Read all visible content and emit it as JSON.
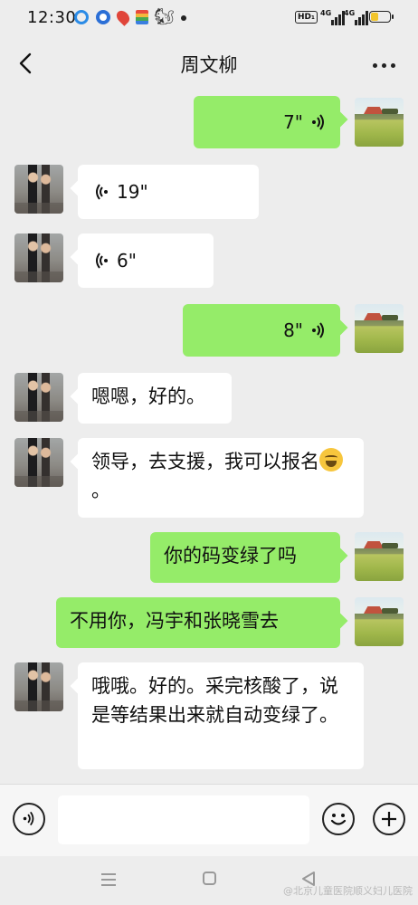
{
  "status_bar": {
    "time": "12:30",
    "hd_label": "HD₁",
    "sig1": "4G",
    "sig2": "4G"
  },
  "nav": {
    "title": "周文柳"
  },
  "messages": [
    {
      "from": "me",
      "type": "voice",
      "duration": "7\""
    },
    {
      "from": "other",
      "type": "voice",
      "duration": "19\""
    },
    {
      "from": "other",
      "type": "voice",
      "duration": "6\""
    },
    {
      "from": "me",
      "type": "voice",
      "duration": "8\""
    },
    {
      "from": "other",
      "type": "text",
      "text": "嗯嗯，好的。"
    },
    {
      "from": "other",
      "type": "text",
      "text": "领导，去支援，我可以报名",
      "trail": "。",
      "emoji": "laughing-tears-emoji"
    },
    {
      "from": "me",
      "type": "text",
      "text": "你的码变绿了吗"
    },
    {
      "from": "me",
      "type": "text",
      "text": "不用你，冯宇和张晓雪去"
    },
    {
      "from": "other",
      "type": "text",
      "text": "哦哦。好的。采完核酸了，说是等结果出来就自动变绿了。"
    }
  ],
  "input": {
    "placeholder": ""
  },
  "watermark": "@北京儿童医院顺义妇儿医院",
  "colors": {
    "background": "#ededed",
    "outgoing_bubble": "#95ec69",
    "incoming_bubble": "#ffffff"
  },
  "icons": [
    "back-icon",
    "more-icon",
    "voice-wave-icon",
    "voice-toggle-icon",
    "emoji-icon",
    "plus-icon",
    "menu-icon",
    "home-icon",
    "back-triangle-icon"
  ]
}
